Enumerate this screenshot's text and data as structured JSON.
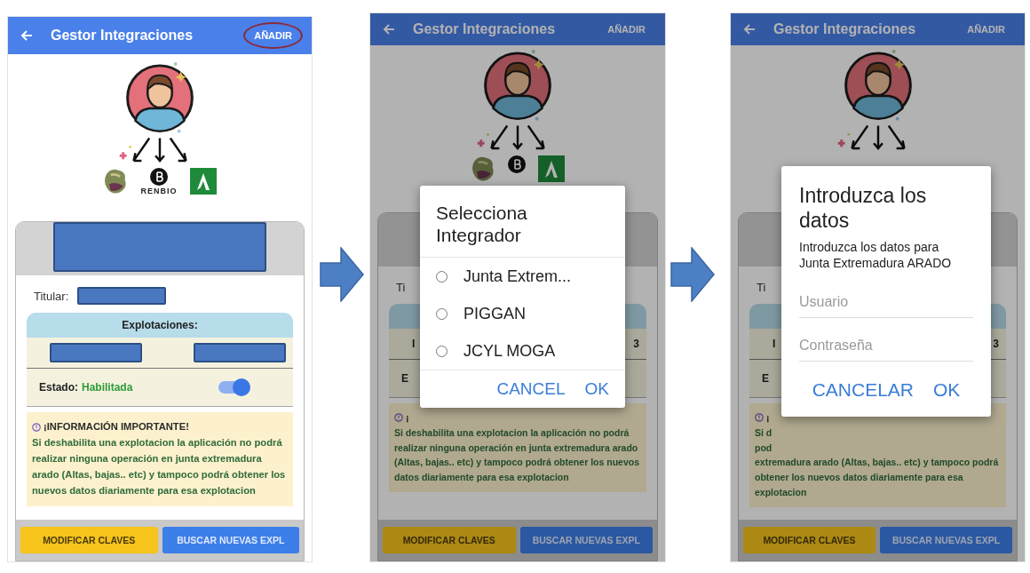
{
  "panels": [
    {
      "kind": "main",
      "app_bar": {
        "title": "Gestor Integraciones",
        "action": {
          "label": "AÑADIR",
          "highlighted": true
        }
      },
      "illustration": {
        "logos": [
          {
            "kind": "plant"
          },
          {
            "kind": "circle"
          },
          {
            "kind": "square"
          }
        ],
        "caption": "RENBIO"
      },
      "card": {
        "header_redacted": true,
        "titular": {
          "label": "Titular:",
          "value_redacted": true
        },
        "explotaciones_header": "Explotaciones:",
        "cells": [
          {
            "redacted": true
          },
          {
            "redacted": true
          }
        ],
        "estado_label": "Estado:",
        "estado_value": "Habilitada",
        "toggle_on": true,
        "info_title": "¡INFORMACIÓN IMPORTANTE!",
        "info_lines": [
          "Si deshabilita una explotacion la aplicación no podrá realizar ninguna operación en junta extremadura arado (Altas, bajas.. etc) y tampoco podrá obtener los nuevos datos diariamente para esa explotacion"
        ]
      },
      "buttons": [
        {
          "label": "MODIFICAR CLAVES",
          "kind": "secondary"
        },
        {
          "label": "BUSCAR NUEVAS EXPL",
          "kind": "primary"
        }
      ]
    },
    {
      "kind": "dialog",
      "app_bar": {
        "title": "Gestor Integraciones",
        "action": {
          "label": "AÑADIR"
        }
      },
      "illustration": {
        "logos": [
          {
            "kind": "plant"
          },
          {
            "kind": "circle"
          },
          {
            "kind": "square"
          }
        ]
      },
      "card": {
        "titular": {
          "label": "Ti"
        },
        "cells": [
          {
            "text": "I"
          },
          {
            "text": "3"
          }
        ],
        "estado_label": "E",
        "info_title": "¡",
        "info_lines": [
          "Si deshabilita una explotacion la aplicación no podrá realizar ninguna operación en junta extremadura arado (Altas, bajas.. etc) y tampoco podrá obtener los nuevos datos diariamente para esa explotacion"
        ]
      },
      "buttons": [
        {
          "label": "MODIFICAR CLAVES",
          "kind": "secondary"
        },
        {
          "label": "BUSCAR NUEVAS EXPL",
          "kind": "primary"
        }
      ],
      "dialog": {
        "kind": "choice",
        "title": "Selecciona Integrador",
        "options": [
          {
            "label": "Junta Extrem...",
            "selected": false
          },
          {
            "label": "PIGGAN",
            "selected": false
          },
          {
            "label": "JCYL MOGA",
            "selected": false
          }
        ],
        "actions": [
          "CANCEL",
          "OK"
        ]
      }
    },
    {
      "kind": "dialog",
      "app_bar": {
        "title": "Gestor Integraciones",
        "action": {
          "label": "AÑADIR"
        }
      },
      "card": {
        "titular": {
          "label": "Ti"
        },
        "cells": [
          {
            "text": "I"
          },
          {
            "text": "3"
          }
        ],
        "estado_label": "E",
        "info_title": "¡",
        "info_lines": [
          "Si d",
          "pod",
          "extremadura arado (Altas, bajas.. etc) y tampoco podrá obtener los nuevos datos diariamente para esa explotacion"
        ]
      },
      "buttons": [
        {
          "label": "MODIFICAR CLAVES",
          "kind": "secondary"
        },
        {
          "label": "BUSCAR NUEVAS EXPL",
          "kind": "primary"
        }
      ],
      "dialog": {
        "kind": "form",
        "title": "Introduzca los datos",
        "message": "Introduzca los datos para Junta Extremadura ARADO",
        "fields": [
          {
            "placeholder": "Usuario"
          },
          {
            "placeholder": "Contraseña"
          }
        ],
        "actions": [
          "CANCELAR",
          "OK"
        ]
      }
    }
  ]
}
